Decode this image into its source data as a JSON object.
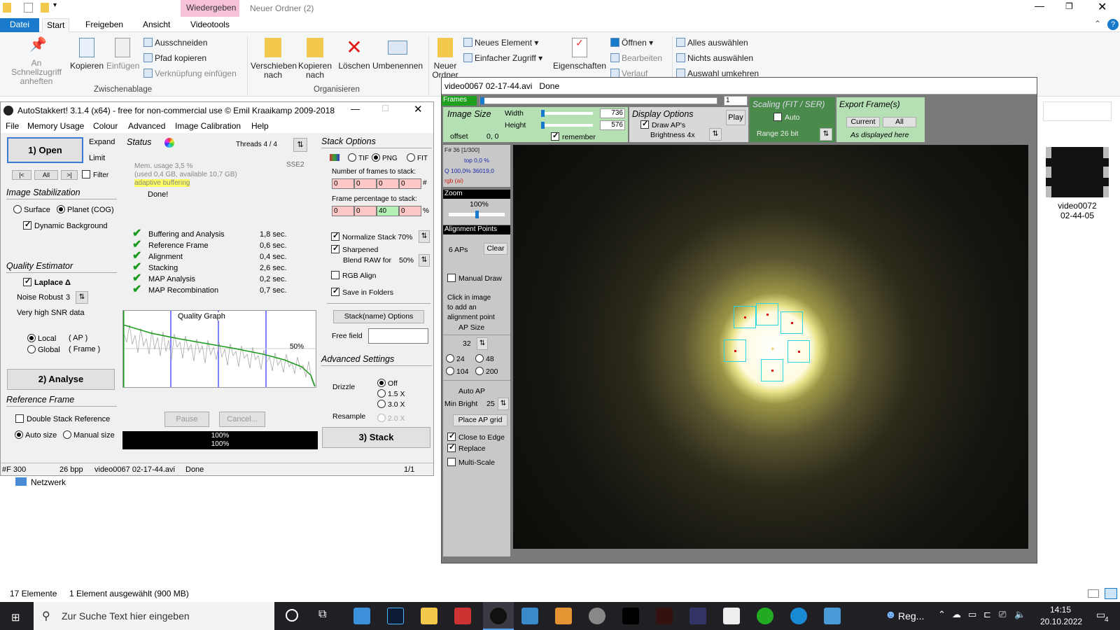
{
  "explorer": {
    "title": "Neuer Ordner (2)",
    "context_tab": "Wiedergeben",
    "tabs": [
      "Datei",
      "Start",
      "Freigeben",
      "Ansicht",
      "Videotools"
    ],
    "ribbon": {
      "pin": "An Schnellzugriff anheften",
      "copy": "Kopieren",
      "paste": "Einfügen",
      "cut": "Ausschneiden",
      "copy_path": "Pfad kopieren",
      "paste_link": "Verknüpfung einfügen",
      "group_clipboard": "Zwischenablage",
      "move": "Verschieben nach",
      "copyto": "Kopieren nach",
      "delete": "Löschen",
      "rename": "Umbenennen",
      "group_organize": "Organisieren",
      "newfolder": "Neuer Ordner",
      "newitem": "Neues Element",
      "easyaccess": "Einfacher Zugriff",
      "properties": "Eigenschaften",
      "open": "Öffnen",
      "edit": "Bearbeiten",
      "history": "Verlauf",
      "selectall": "Alles auswählen",
      "selectnone": "Nichts auswählen",
      "invert": "Auswahl umkehren"
    },
    "network": "Netzwerk",
    "thumb_label": "video0072\n02-44-05",
    "status_count": "17 Elemente",
    "status_sel": "1 Element ausgewählt (900 MB)"
  },
  "taskbar": {
    "search": "Zur Suche Text hier eingeben",
    "reg": "Reg...",
    "time": "14:15",
    "date": "20.10.2022",
    "notif": "4"
  },
  "as": {
    "title": "AutoStakkert! 3.1.4 (x64) - free for non-commercial use © Emil Kraaikamp 2009-2018",
    "menu": [
      "File",
      "Memory Usage",
      "Colour",
      "Advanced",
      "Image Calibration",
      "Help"
    ],
    "open": "1) Open",
    "expand": "Expand",
    "limit": "Limit",
    "nav": [
      "|<",
      "All",
      ">|"
    ],
    "filter": "Filter",
    "stab": "Image Stabilization",
    "surface": "Surface",
    "planet": "Planet (COG)",
    "dynbg": "Dynamic Background",
    "qe": "Quality Estimator",
    "laplace": "Laplace Δ",
    "noise": "Noise Robust",
    "noise_val": "3",
    "snr": "Very high SNR data",
    "local": "Local",
    "local_ap": "( AP )",
    "global": "Global",
    "global_fr": "( Frame )",
    "analyse": "2) Analyse",
    "ref": "Reference Frame",
    "double": "Double Stack Reference",
    "autosize": "Auto size",
    "manualsize": "Manual size",
    "status": "Status",
    "threads": "Threads 4 / 4",
    "sse": "SSE2",
    "mem1": "Mem. usage 3,5 %",
    "mem2": "(used 0,4 GB, available 10,7 GB)",
    "adaptive": "adaptive buffering",
    "done": "Done!",
    "steps": [
      {
        "name": "Buffering and Analysis",
        "time": "1,8 sec."
      },
      {
        "name": "Reference Frame",
        "time": "0,6 sec."
      },
      {
        "name": "Alignment",
        "time": "0,4 sec."
      },
      {
        "name": "Stacking",
        "time": "2,6 sec."
      },
      {
        "name": "MAP Analysis",
        "time": "0,2 sec."
      },
      {
        "name": "MAP Recombination",
        "time": "0,7 sec."
      }
    ],
    "qgraph": "Quality Graph",
    "q50": "50%",
    "pause": "Pause",
    "cancel": "Cancel...",
    "prog1": "100%",
    "prog2": "100%",
    "stackopt": "Stack Options",
    "tif": "TIF",
    "png": "PNG",
    "fit": "FIT",
    "nframes": "Number of frames to stack:",
    "nf": [
      "0",
      "0",
      "0",
      "0"
    ],
    "hash": "#",
    "fpct": "Frame percentage to stack:",
    "fp": [
      "0",
      "0",
      "40",
      "0"
    ],
    "pct": "%",
    "normalize": "Normalize Stack 70%",
    "sharpened": "Sharpened",
    "blend": "Blend RAW for",
    "blend_val": "50%",
    "rgbalign": "RGB Align",
    "savefolders": "Save in Folders",
    "stackname": "Stack(name) Options",
    "freefield": "Free field",
    "advset": "Advanced Settings",
    "drizzle": "Drizzle",
    "dz": [
      "Off",
      "1.5 X",
      "3.0 X"
    ],
    "resample": "Resample",
    "rs": "2.0 X",
    "stack": "3) Stack",
    "sb_f": "#F 300",
    "sb_bpp": "26 bpp",
    "sb_file": "video0067 02-17-44.avi",
    "sb_done": "Done",
    "sb_page": "1/1"
  },
  "iw": {
    "title": "video0067 02-17-44.avi   Done",
    "frames": "Frames",
    "frame_val": "1",
    "imgsize": "Image Size",
    "width": "Width",
    "width_val": "736",
    "height": "Height",
    "height_val": "576",
    "offset": "offset",
    "offset_val": "0, 0",
    "remember": "remember",
    "dispopt": "Display Options",
    "drawaps": "Draw AP's",
    "bright": "Brightness 4x",
    "play": "Play",
    "scaling": "Scaling (FIT / SER)",
    "auto": "Auto",
    "range": "Range 26 bit",
    "export": "Export Frame(s)",
    "current": "Current",
    "all": "All",
    "asdisp": "As displayed here",
    "finfo1": "F# 36 [1/300]",
    "finfo2": "top 0,0 %",
    "finfo3": "Q 100,0%  36019,0",
    "finfo4": "rgb (ai)",
    "zoom": "Zoom",
    "zoom_val": "100%",
    "ap": "Alignment Points",
    "aps": "6 APs",
    "clear": "Clear",
    "manual": "Manual Draw",
    "hint": "Click in image\nto add an\nalignment point",
    "apsize": "AP Size",
    "apsize_val": "32",
    "sizes": [
      "24",
      "48",
      "104",
      "200"
    ],
    "autoap": "Auto AP",
    "minbright": "Min Bright",
    "minbright_val": "25",
    "placegrid": "Place AP grid",
    "close": "Close to Edge",
    "replace": "Replace",
    "multiscale": "Multi-Scale"
  }
}
